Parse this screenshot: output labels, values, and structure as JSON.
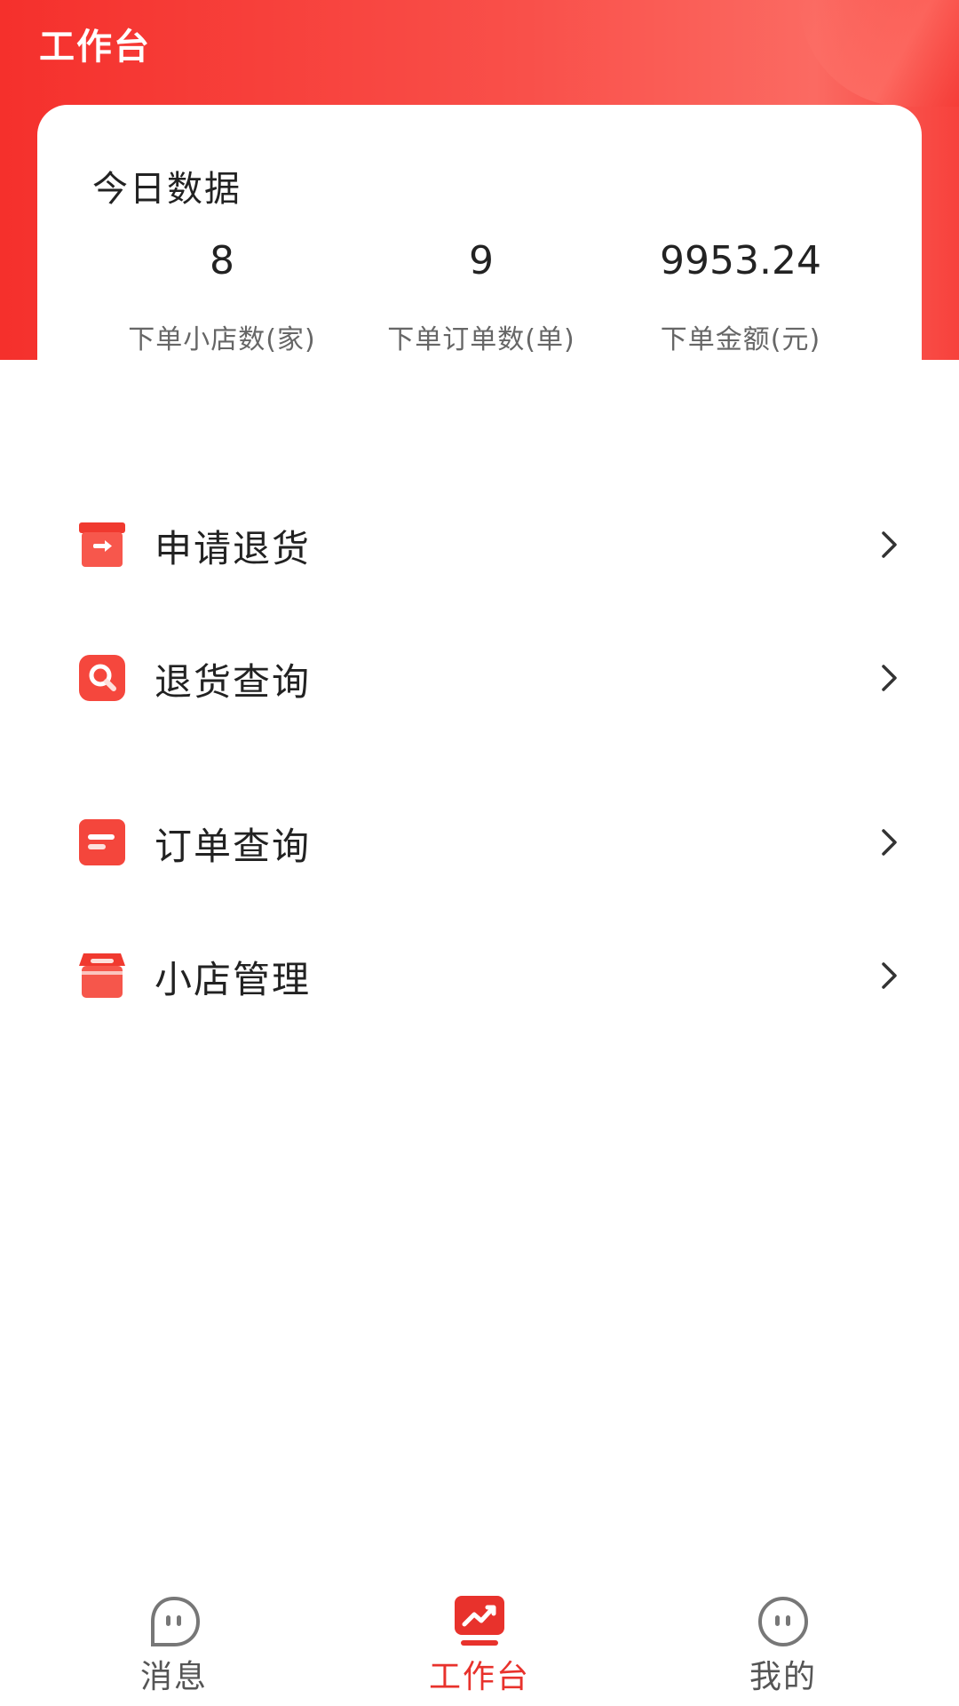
{
  "header": {
    "title": "工作台"
  },
  "today": {
    "title": "今日数据",
    "stats": [
      {
        "value": "8",
        "label": "下单小店数(家)"
      },
      {
        "value": "9",
        "label": "下单订单数(单)"
      },
      {
        "value": "9953.24",
        "label": "下单金额(元)"
      }
    ]
  },
  "menu": [
    {
      "label": "申请退货",
      "icon": "return-box-icon"
    },
    {
      "label": "退货查询",
      "icon": "search-icon"
    },
    {
      "label": "订单查询",
      "icon": "order-list-icon"
    },
    {
      "label": "小店管理",
      "icon": "store-icon"
    }
  ],
  "tabbar": {
    "tabs": [
      {
        "label": "消息",
        "icon": "message-icon",
        "active": false
      },
      {
        "label": "工作台",
        "icon": "chart-trend-icon",
        "active": true
      },
      {
        "label": "我的",
        "icon": "profile-icon",
        "active": false
      }
    ]
  },
  "colors": {
    "accent": "#f5302c",
    "active_tab": "#e8322c",
    "inactive_tab": "#555555"
  }
}
